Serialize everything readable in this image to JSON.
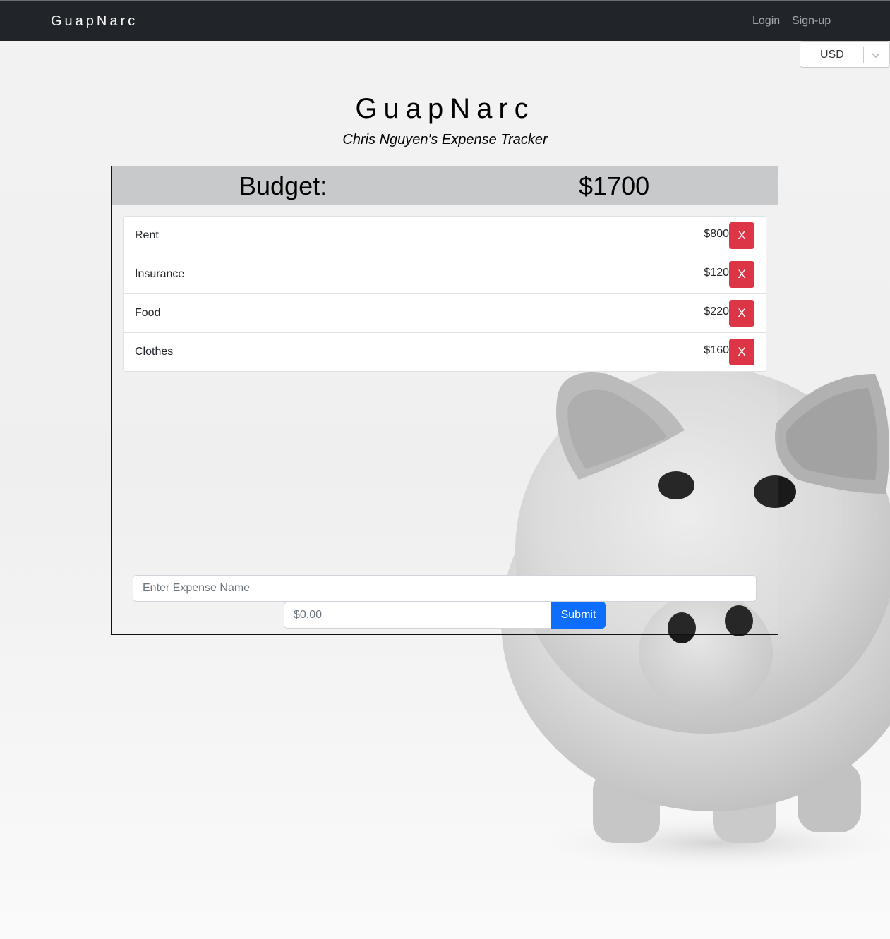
{
  "navbar": {
    "brand": "GuapNarc",
    "links": {
      "login": "Login",
      "signup": "Sign-up"
    }
  },
  "currency": {
    "selected": "USD"
  },
  "header": {
    "title": "GuapNarc",
    "subtitle": "Chris Nguyen's Expense Tracker"
  },
  "budget": {
    "label": "Budget:",
    "value": "$1700"
  },
  "expenses": [
    {
      "name": "Rent",
      "amount": "$800",
      "delete_label": "X"
    },
    {
      "name": "Insurance",
      "amount": "$120",
      "delete_label": "X"
    },
    {
      "name": "Food",
      "amount": "$220",
      "delete_label": "X"
    },
    {
      "name": "Clothes",
      "amount": "$160",
      "delete_label": "X"
    }
  ],
  "form": {
    "name_placeholder": "Enter Expense Name",
    "amount_placeholder": "$0.00",
    "submit_label": "Submit"
  },
  "colors": {
    "navbar": "#212529",
    "budget_bar": "#c8c9cb",
    "danger": "#dc3545",
    "primary": "#0d6efd"
  },
  "icons": {
    "currency_dropdown": "chevron-down-icon",
    "background": "piggy-bank-image"
  }
}
